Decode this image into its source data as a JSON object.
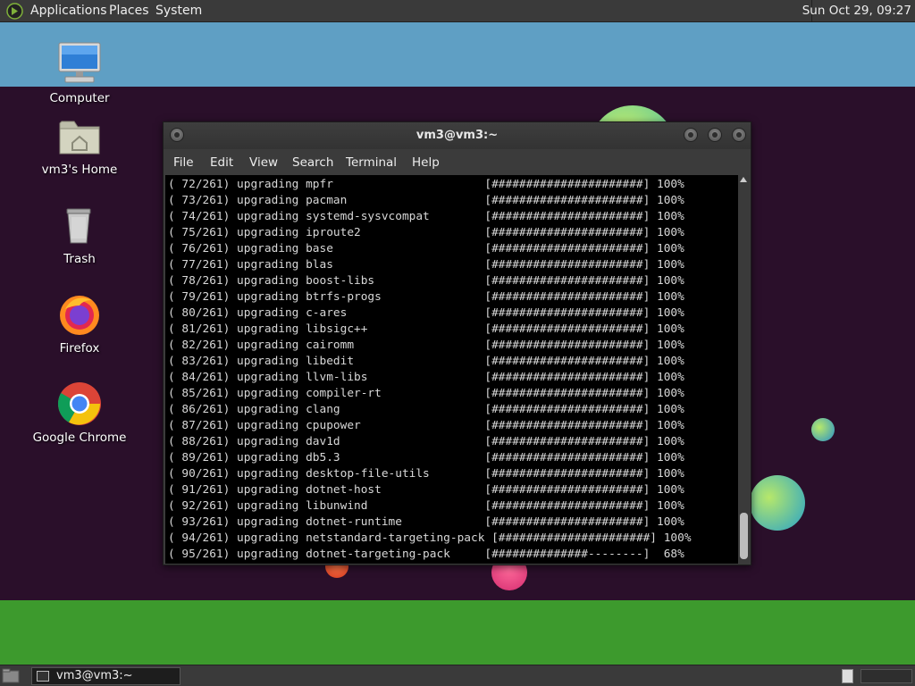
{
  "top_panel": {
    "menus": [
      "Applications",
      "Places",
      "System"
    ],
    "clock": "Sun Oct 29, 09:27"
  },
  "desktop_icons": [
    {
      "label": "Computer",
      "icon": "computer-icon"
    },
    {
      "label": "vm3's Home",
      "icon": "home-folder-icon"
    },
    {
      "label": "Trash",
      "icon": "trash-icon"
    },
    {
      "label": "Firefox",
      "icon": "firefox-icon"
    },
    {
      "label": "Google Chrome",
      "icon": "chrome-icon"
    }
  ],
  "terminal": {
    "title": "vm3@vm3:~",
    "menu": [
      "File",
      "Edit",
      "View",
      "Search",
      "Terminal",
      "Help"
    ],
    "lines": [
      "( 72/261) upgrading mpfr                      [######################] 100%",
      "( 73/261) upgrading pacman                    [######################] 100%",
      "( 74/261) upgrading systemd-sysvcompat        [######################] 100%",
      "( 75/261) upgrading iproute2                  [######################] 100%",
      "( 76/261) upgrading base                      [######################] 100%",
      "( 77/261) upgrading blas                      [######################] 100%",
      "( 78/261) upgrading boost-libs                [######################] 100%",
      "( 79/261) upgrading btrfs-progs               [######################] 100%",
      "( 80/261) upgrading c-ares                    [######################] 100%",
      "( 81/261) upgrading libsigc++                 [######################] 100%",
      "( 82/261) upgrading cairomm                   [######################] 100%",
      "( 83/261) upgrading libedit                   [######################] 100%",
      "( 84/261) upgrading llvm-libs                 [######################] 100%",
      "( 85/261) upgrading compiler-rt               [######################] 100%",
      "( 86/261) upgrading clang                     [######################] 100%",
      "( 87/261) upgrading cpupower                  [######################] 100%",
      "( 88/261) upgrading dav1d                     [######################] 100%",
      "( 89/261) upgrading db5.3                     [######################] 100%",
      "( 90/261) upgrading desktop-file-utils        [######################] 100%",
      "( 91/261) upgrading dotnet-host               [######################] 100%",
      "( 92/261) upgrading libunwind                 [######################] 100%",
      "( 93/261) upgrading dotnet-runtime            [######################] 100%",
      "( 94/261) upgrading netstandard-targeting-pack [######################] 100%",
      "( 95/261) upgrading dotnet-targeting-pack     [##############--------]  68%"
    ]
  },
  "taskbar": {
    "task_label": "vm3@vm3:~"
  }
}
